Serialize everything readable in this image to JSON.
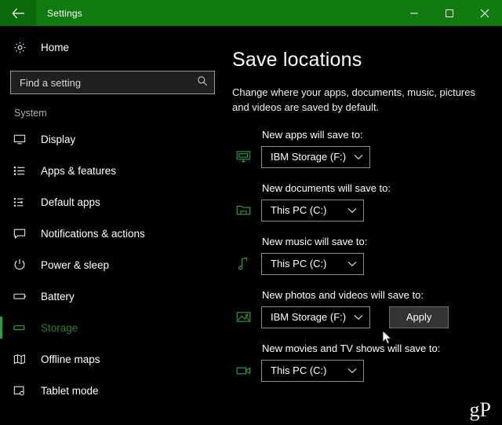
{
  "window": {
    "title": "Settings",
    "accent_color": "#107c10",
    "back_icon": "back-arrow-icon",
    "minimize_label": "—",
    "maximize_label": "□",
    "close_label": "✕"
  },
  "sidebar": {
    "home": {
      "label": "Home",
      "icon": "gear-icon"
    },
    "search": {
      "placeholder": "Find a setting",
      "value": "",
      "icon": "search-icon"
    },
    "section_label": "System",
    "items": [
      {
        "label": "Display",
        "icon": "monitor-icon",
        "selected": false
      },
      {
        "label": "Apps & features",
        "icon": "list-icon",
        "selected": false
      },
      {
        "label": "Default apps",
        "icon": "default-apps-icon",
        "selected": false
      },
      {
        "label": "Notifications & actions",
        "icon": "notification-icon",
        "selected": false
      },
      {
        "label": "Power & sleep",
        "icon": "power-icon",
        "selected": false
      },
      {
        "label": "Battery",
        "icon": "battery-icon",
        "selected": false
      },
      {
        "label": "Storage",
        "icon": "storage-icon",
        "selected": true
      },
      {
        "label": "Offline maps",
        "icon": "map-icon",
        "selected": false
      },
      {
        "label": "Tablet mode",
        "icon": "tablet-icon",
        "selected": false
      }
    ],
    "selected_color": "#2f7d32"
  },
  "main": {
    "title": "Save locations",
    "description": "Change where your apps, documents, music, pictures and videos are saved by default.",
    "groups": [
      {
        "label": "New apps will save to:",
        "icon": "monitor-apps-icon",
        "value": "IBM Storage (F:)",
        "has_apply": false
      },
      {
        "label": "New documents will save to:",
        "icon": "folder-icon",
        "value": "This PC (C:)",
        "has_apply": false
      },
      {
        "label": "New music will save to:",
        "icon": "music-note-icon",
        "value": "This PC (C:)",
        "has_apply": false
      },
      {
        "label": "New photos and videos will save to:",
        "icon": "picture-icon",
        "value": "IBM Storage (F:)",
        "has_apply": true,
        "apply_label": "Apply"
      },
      {
        "label": "New movies and TV shows will save to:",
        "icon": "video-camera-icon",
        "value": "This PC (C:)",
        "has_apply": false
      }
    ],
    "watermark": "gP"
  }
}
